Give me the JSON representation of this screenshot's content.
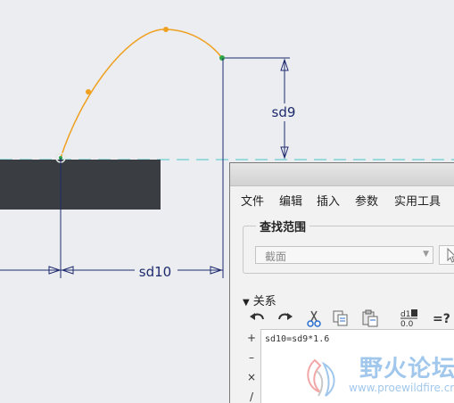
{
  "sketch": {
    "dim_height_label": "sd9",
    "dim_width_label": "sd10"
  },
  "dialog": {
    "menu": [
      "文件",
      "编辑",
      "插入",
      "参数",
      "实用工具"
    ],
    "look_in": {
      "legend": "查找范围",
      "value": "截面"
    },
    "relations_section": "关系",
    "toolbar_icons": [
      "undo-icon",
      "redo-icon",
      "cut-icon",
      "copy-icon",
      "paste-icon",
      "show-values-icon",
      "verify-icon"
    ],
    "toolbar_text": {
      "values_top": "d1",
      "values_bottom": "0.0",
      "verify": "=?"
    },
    "sidebar_ops": [
      "+",
      "–",
      "×",
      "/"
    ],
    "relation_text": "sd10=sd9*1.6"
  },
  "watermark": {
    "title": "野火论坛",
    "url": "www.proewildfire.cn"
  },
  "colors": {
    "canvas_bg": "#ebedf0",
    "arc": "#f0a020",
    "dimension": "#1e2a6e",
    "centerline": "#4bc7c7",
    "solid_block": "#3a3d42",
    "watermark": "#9cc6ec"
  }
}
